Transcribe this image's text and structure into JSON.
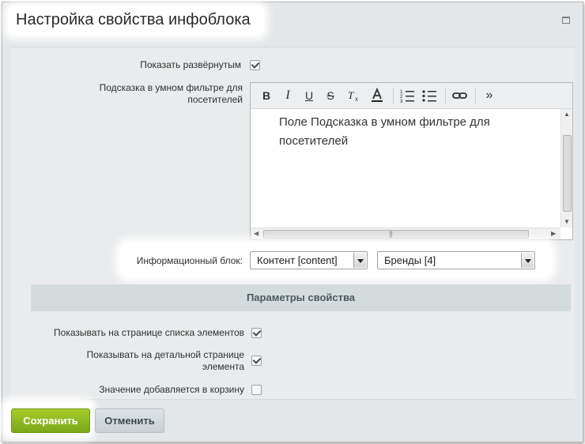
{
  "dialog": {
    "title": "Настройка свойства инфоблока",
    "maximize_icon": "maximize-icon"
  },
  "form": {
    "show_expanded_label": "Показать развёрнутым",
    "show_expanded_checked": true,
    "hint_label": "Подсказка в умном фильтре для посетителей",
    "editor": {
      "toolbar_icons": [
        "bold-icon",
        "italic-icon",
        "underline-icon",
        "strikethrough-icon",
        "clear-format-icon",
        "font-color-icon",
        "ordered-list-icon",
        "unordered-list-icon",
        "link-icon",
        "more-icon"
      ],
      "toolbar_glyphs": {
        "bold": "B",
        "italic": "I",
        "underline": "U",
        "strike": "S",
        "more": "»"
      },
      "content": "Поле Подсказка в умном фильтре для посетителей",
      "grip_glyph": "|||"
    },
    "iblock_label": "Информационный блок:",
    "iblock_type_value": "Контент [content]",
    "iblock_value": "Бренды [4]"
  },
  "section": {
    "header": "Параметры свойства",
    "show_in_list_label": "Показывать на странице списка элементов",
    "show_in_list_checked": true,
    "show_in_detail_label": "Показывать на детальной странице элемента",
    "show_in_detail_checked": true,
    "add_to_basket_label": "Значение добавляется в корзину",
    "add_to_basket_checked": false
  },
  "footer": {
    "save_label": "Сохранить",
    "cancel_label": "Отменить"
  },
  "colors": {
    "save_button": "#8cbb21",
    "section_header": "#d4dbdd",
    "dialog_bg": "#e4e7e9"
  }
}
